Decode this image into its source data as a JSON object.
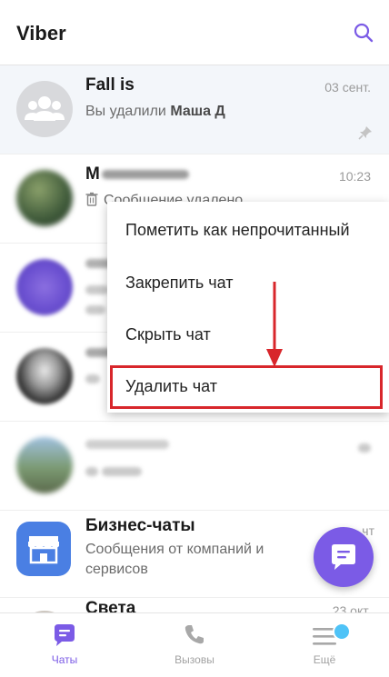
{
  "app": {
    "title": "Viber"
  },
  "chats": [
    {
      "name": "Fall is",
      "preview_prefix": "Вы удалили ",
      "preview_name": "Маша Д",
      "time": "03 сент."
    },
    {
      "name": "М",
      "preview": "Сообщение удалено",
      "time": "10:23"
    },
    {
      "name": "",
      "preview": "",
      "time": ""
    },
    {
      "name": "",
      "preview": "",
      "time": ""
    },
    {
      "name": "",
      "preview": "",
      "time": ""
    },
    {
      "name": "Бизнес-чаты",
      "preview": "Сообщения от компаний и сервисов",
      "time": "чт"
    },
    {
      "name": "Света",
      "preview": "",
      "time": "23 окт."
    }
  ],
  "context_menu": {
    "items": [
      "Пометить как непрочитанный",
      "Закрепить чат",
      "Скрыть чат",
      "Удалить чат"
    ]
  },
  "tabs": [
    {
      "label": "Чаты",
      "active": true
    },
    {
      "label": "Вызовы",
      "active": false
    },
    {
      "label": "Ещё",
      "active": false
    }
  ],
  "colors": {
    "accent": "#7b5be6",
    "highlight": "#d8262b"
  },
  "icons": [
    "search-icon",
    "group-avatar-icon",
    "pin-icon",
    "trash-icon",
    "store-icon",
    "compose-chat-icon",
    "chat-tab-icon",
    "phone-tab-icon",
    "menu-tab-icon"
  ]
}
